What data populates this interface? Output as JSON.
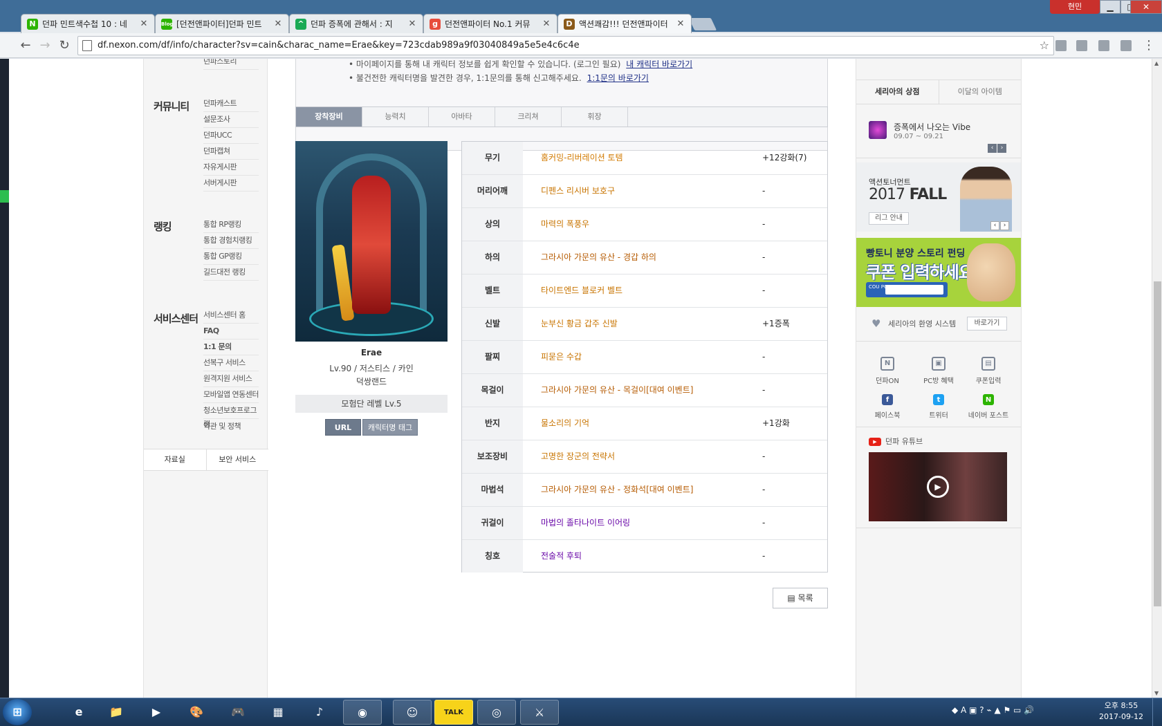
{
  "browser": {
    "tabs": [
      {
        "title": "던파 민트색수첩 10 : 네",
        "favicon": "N",
        "color": "#2db400"
      },
      {
        "title": "[던전앤파이터]던파 민트",
        "favicon": "Blog",
        "color": "#2db400"
      },
      {
        "title": "던파 증폭에 관해서 : 지",
        "favicon": "^",
        "color": "#1aaa55"
      },
      {
        "title": "던전앤파이터 No.1 커뮤",
        "favicon": "g",
        "color": "#e74c3c"
      },
      {
        "title": "액션쾌감!!! 던전앤파이터",
        "favicon": "D",
        "color": "#8a5a1a"
      }
    ],
    "profile_name": "현민",
    "url": "df.nexon.com/df/info/character?sv=cain&charac_name=Erae&key=723cdab989a9f03040849a5e5e4c6c4e"
  },
  "leftnav": {
    "top_item": "던파스토리",
    "sections": [
      {
        "title": "커뮤니티",
        "items": [
          "던파캐스트",
          "설문조사",
          "던파UCC",
          "던파캡쳐",
          "자유게시판",
          "서버게시판"
        ]
      },
      {
        "title": "랭킹",
        "items": [
          "통합 RP랭킹",
          "통합 경험치랭킹",
          "통합 GP랭킹",
          "길드대전 랭킹"
        ]
      },
      {
        "title": "서비스센터",
        "items": [
          "서비스센터 홈",
          "FAQ",
          "1:1 문의",
          "선복구 서비스",
          "원격지원 서비스",
          "모바일앱 연동센터",
          "청소년보호프로그램",
          "약관 및 정책"
        ]
      }
    ],
    "bottom": [
      "자료실",
      "보안 서비스"
    ]
  },
  "notice": {
    "line1": "마이페이지를 통해 내 캐릭터 정보를 쉽게 확인할 수 있습니다. (로그인 필요)",
    "line1_link": "내 캐릭터 바로가기",
    "line2": "불건전한 캐릭터명을 발견한 경우, 1:1문의를 통해 신고해주세요.",
    "line2_link": "1:1문의 바로가기"
  },
  "content_tabs": [
    "장착장비",
    "능력치",
    "아바타",
    "크리쳐",
    "휘장"
  ],
  "character": {
    "name": "Erae",
    "info": "Lv.90 / 저스티스 / 카인",
    "guild": "덕쌍랜드",
    "adventure_level": "모험단 레벨 Lv.5",
    "btn_url": "URL",
    "btn_tag": "캐릭터명 태그"
  },
  "equipment": [
    {
      "slot": "무기",
      "name": "홈커밍-리버레이션 토템",
      "upgrade": "+12강화(7)",
      "grade": "legend"
    },
    {
      "slot": "머리어깨",
      "name": "디펜스 리시버 보호구",
      "upgrade": "-",
      "grade": "epic"
    },
    {
      "slot": "상의",
      "name": "마력의 폭풍우",
      "upgrade": "-",
      "grade": "epic"
    },
    {
      "slot": "하의",
      "name": "그라시아 가문의 유산 - 경갑 하의",
      "upgrade": "-",
      "grade": "unique"
    },
    {
      "slot": "벨트",
      "name": "타이트엔드 블로커 벨트",
      "upgrade": "-",
      "grade": "epic"
    },
    {
      "slot": "신발",
      "name": "눈부신 황금 갑주 신발",
      "upgrade": "+1증폭",
      "grade": "epic",
      "upgrade_grade": "amp"
    },
    {
      "slot": "팔찌",
      "name": "피묻은 수갑",
      "upgrade": "-",
      "grade": "epic"
    },
    {
      "slot": "목걸이",
      "name": "그라시아 가문의 유산 - 목걸이[대여 이벤트]",
      "upgrade": "-",
      "grade": "unique"
    },
    {
      "slot": "반지",
      "name": "물소리의 기억",
      "upgrade": "+1강화",
      "grade": "epic"
    },
    {
      "slot": "보조장비",
      "name": "고명한 장군의 전략서",
      "upgrade": "-",
      "grade": "epic"
    },
    {
      "slot": "마법석",
      "name": "그라시아 가문의 유산 - 정화석[대여 이벤트]",
      "upgrade": "-",
      "grade": "unique"
    },
    {
      "slot": "귀걸이",
      "name": "마법의 졸타나이트 이어링",
      "upgrade": "-",
      "grade": "rare"
    },
    {
      "slot": "칭호",
      "name": "전술적 후퇴",
      "upgrade": "-",
      "grade": "rare"
    }
  ],
  "list_button": "목록",
  "right": {
    "tabs": [
      "세리아의 상점",
      "이달의 아이템"
    ],
    "shop_item": {
      "title": "증폭에서 나오는 Vibe",
      "date": "09.07 ~ 09.21"
    },
    "banner_fall": {
      "small": "액션토너먼트",
      "year": "2017",
      "season": "FALL",
      "btn": "리그 안내"
    },
    "banner_coupon": {
      "line1": "빵토니 분양 스토리 펀딩",
      "line2": "쿠폰 입력하세요!",
      "badge": "COU PON"
    },
    "welcome": {
      "label": "세리아의 환영 시스템",
      "btn": "바로가기"
    },
    "quick": [
      {
        "label": "던파ON",
        "icon": "phone-icon",
        "glyph": "N"
      },
      {
        "label": "PC방 혜택",
        "icon": "gift-icon",
        "glyph": "▣"
      },
      {
        "label": "쿠폰입력",
        "icon": "coupon-icon",
        "glyph": "▤"
      },
      {
        "label": "페이스북",
        "icon": "facebook-icon",
        "glyph": "f"
      },
      {
        "label": "트위터",
        "icon": "twitter-icon",
        "glyph": "t"
      },
      {
        "label": "네이버 포스트",
        "icon": "naver-post-icon",
        "glyph": "N"
      }
    ],
    "youtube_label": "던파 유튜브"
  },
  "taskbar": {
    "apps": [
      "e",
      "📁",
      "▶",
      "🎨",
      "🎮",
      "▦",
      "♪",
      "◉",
      "☺",
      "TALK",
      "◎",
      "⚔"
    ],
    "clock_time": "오후 8:55",
    "clock_date": "2017-09-12"
  }
}
